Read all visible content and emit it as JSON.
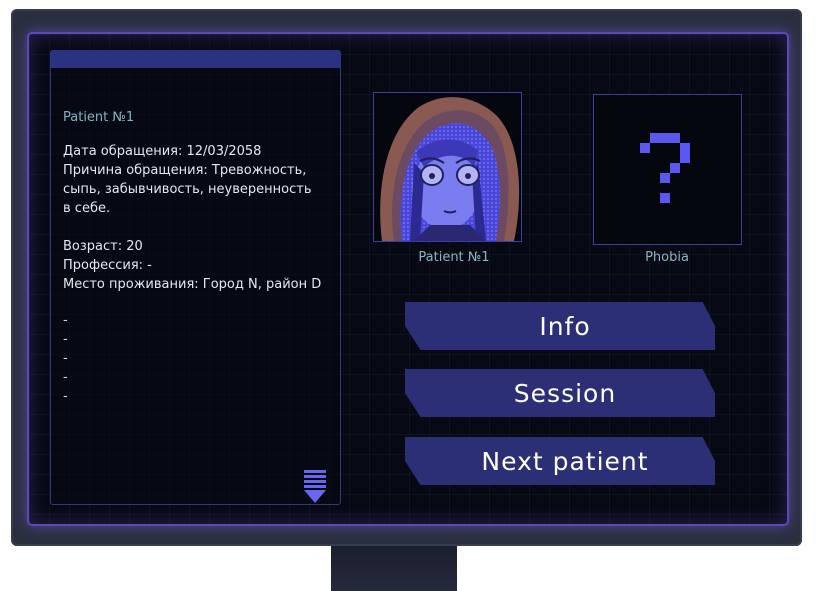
{
  "patient_card": {
    "title": "Patient №1",
    "lines": [
      "Дата обращения: 12/03/2058",
      "Причина обращения: Тревожность,",
      "сыпь, забывчивость, неуверенность",
      "в себе.",
      "Возраст: 20",
      "Профессия: -",
      "Место проживания: Город N, район D"
    ],
    "dashes": [
      "-",
      "-",
      "-",
      "-",
      "-"
    ]
  },
  "portrait": {
    "caption": "Patient №1"
  },
  "phobia": {
    "caption": "Phobia",
    "symbol": "?"
  },
  "buttons": {
    "info": "Info",
    "session": "Session",
    "next": "Next patient"
  },
  "colors": {
    "accent": "#2c2e76",
    "panel_header": "#2c3282",
    "screen_glow": "#5d4ab0",
    "caption": "#8ab4c2",
    "question_mark": "#5b57f0"
  },
  "icons": [
    "scroll-down-arrow-icon",
    "question-mark-icon"
  ]
}
